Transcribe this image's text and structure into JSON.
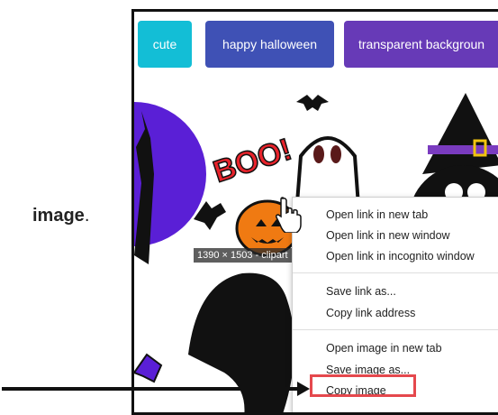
{
  "side_text": {
    "word": "image",
    "punct": "."
  },
  "chips": [
    {
      "label": "cute",
      "color": "#13bed6"
    },
    {
      "label": "happy halloween",
      "color": "#3f51b5"
    },
    {
      "label": "transparent backgroun",
      "color": "#673ab7"
    }
  ],
  "artwork": {
    "boo_text": "BOO!"
  },
  "tooltip": "1390 × 1503 - clipart",
  "context_menu": {
    "items": [
      "Open link in new tab",
      "Open link in new window",
      "Open link in incognito window",
      "Save link as...",
      "Copy link address",
      "Open image in new tab",
      "Save image as...",
      "Copy image"
    ],
    "highlighted": "Copy image",
    "highlight_color": "#e5484d"
  }
}
